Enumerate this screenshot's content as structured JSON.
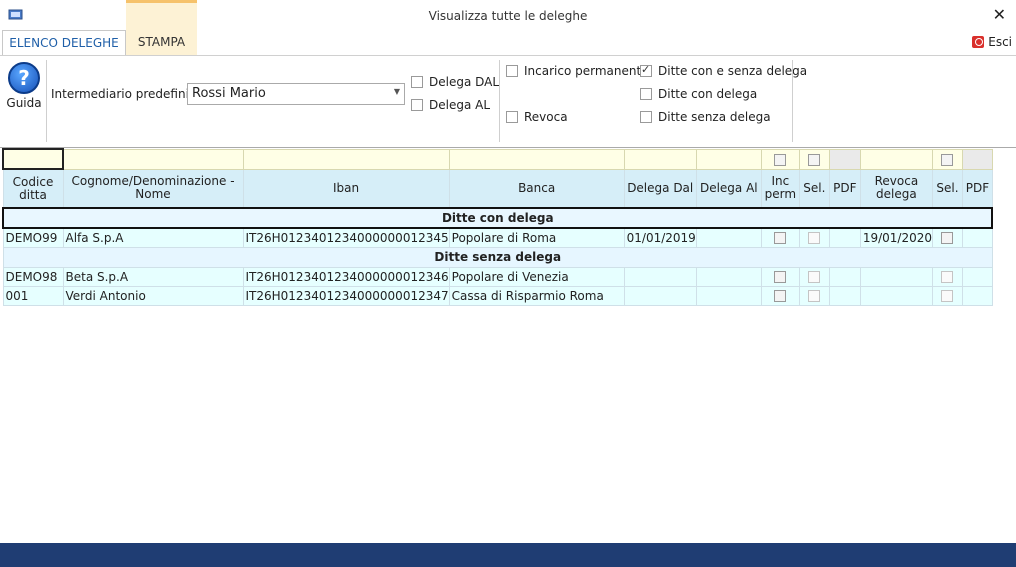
{
  "window": {
    "title": "Visualizza tutte le deleghe",
    "exit_label": "Esci"
  },
  "tabs": [
    {
      "label": "ELENCO DELEGHE"
    },
    {
      "label": "STAMPA"
    }
  ],
  "ribbon": {
    "help_label": "Guida",
    "intermediary_label": "Intermediario predefinito",
    "intermediary_value": "Rossi Mario",
    "delega_dal_label": "Delega DAL",
    "delega_al_label": "Delega AL",
    "incarico_label": "Incarico permanente",
    "revoca_label": "Revoca",
    "ditte_all_label": "Ditte con e senza delega",
    "ditte_con_label": "Ditte con delega",
    "ditte_senza_label": "Ditte senza delega"
  },
  "grid": {
    "columns": [
      "Codice ditta",
      "Cognome/Denominazione - Nome",
      "Iban",
      "Banca",
      "Delega Dal",
      "Delega Al",
      "Inc perm",
      "Sel.",
      "PDF",
      "Revoca delega",
      "Sel.",
      "PDF"
    ],
    "group_con": "Ditte con delega",
    "group_senza": "Ditte senza delega",
    "rows_con": [
      {
        "codice": "DEMO99",
        "nome": "Alfa S.p.A",
        "iban": "IT26H0123401234000000012345",
        "banca": "Popolare di Roma",
        "dal": "01/01/2019",
        "al": "",
        "revoca": "19/01/2020"
      }
    ],
    "rows_senza": [
      {
        "codice": "DEMO98",
        "nome": "Beta S.p.A",
        "iban": "IT26H0123401234000000012346",
        "banca": "Popolare di Venezia",
        "dal": "",
        "al": "",
        "revoca": ""
      },
      {
        "codice": "001",
        "nome": "Verdi Antonio",
        "iban": "IT26H0123401234000000012347",
        "banca": "Cassa di Risparmio Roma",
        "dal": "",
        "al": "",
        "revoca": ""
      }
    ]
  }
}
